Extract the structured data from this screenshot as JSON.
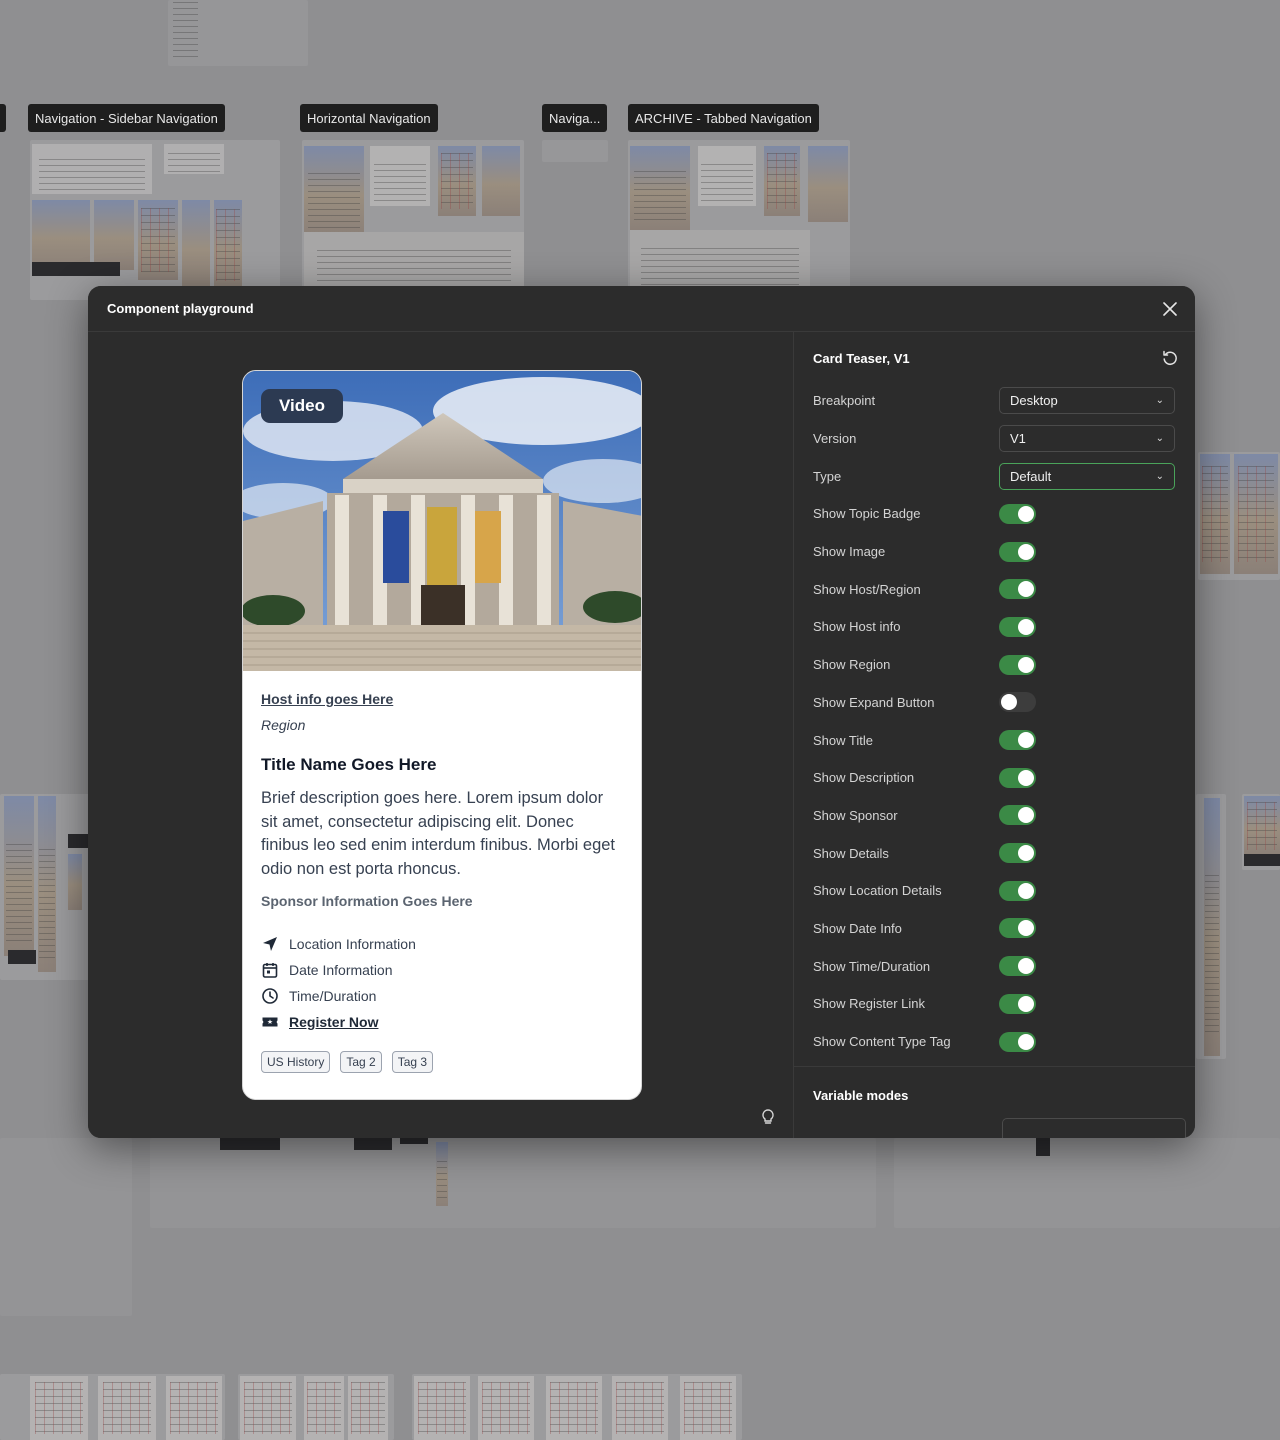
{
  "canvas": {
    "frame_labels": [
      {
        "id": "sidebar",
        "text": "Navigation - Sidebar Navigation"
      },
      {
        "id": "horizontal",
        "text": "Horizontal Navigation"
      },
      {
        "id": "naviga",
        "text": "Naviga..."
      },
      {
        "id": "archive",
        "text": "ARCHIVE - Tabbed Navigation"
      }
    ]
  },
  "modal": {
    "title": "Component playground",
    "close_icon": "close-icon"
  },
  "card": {
    "topic_badge": "Video",
    "image_alt": "museum-building-photo",
    "host_info": "Host info goes Here",
    "region": "Region",
    "title": "Title Name Goes Here",
    "description": "Brief description goes here. Lorem ipsum dolor sit amet, consectetur adipiscing elit. Donec finibus leo sed enim interdum finibus. Morbi eget odio non est porta rhoncus.",
    "sponsor": "Sponsor Information Goes Here",
    "details": {
      "location": "Location Information",
      "date": "Date Information",
      "time": "Time/Duration",
      "register": "Register Now"
    },
    "tags": [
      "US History",
      "Tag 2",
      "Tag 3"
    ]
  },
  "settings": {
    "title": "Card Teaser, V1",
    "selects": {
      "breakpoint": {
        "label": "Breakpoint",
        "value": "Desktop"
      },
      "version": {
        "label": "Version",
        "value": "V1"
      },
      "type": {
        "label": "Type",
        "value": "Default"
      }
    },
    "toggles": [
      {
        "label": "Show Topic Badge",
        "on": true
      },
      {
        "label": "Show Image",
        "on": true
      },
      {
        "label": "Show Host/Region",
        "on": true
      },
      {
        "label": "Show Host info",
        "on": true
      },
      {
        "label": "Show Region",
        "on": true
      },
      {
        "label": "Show Expand Button",
        "on": false
      },
      {
        "label": "Show Title",
        "on": true
      },
      {
        "label": "Show Description",
        "on": true
      },
      {
        "label": "Show Sponsor",
        "on": true
      },
      {
        "label": "Show Details",
        "on": true
      },
      {
        "label": "Show Location Details",
        "on": true
      },
      {
        "label": "Show Date Info",
        "on": true
      },
      {
        "label": "Show Time/Duration",
        "on": true
      },
      {
        "label": "Show Register Link",
        "on": true
      },
      {
        "label": "Show Content Type Tag",
        "on": true
      }
    ],
    "variable_modes_title": "Variable modes"
  },
  "colors": {
    "toggle_on": "#3b8a46",
    "toggle_off": "#3d3d3d",
    "modal_bg": "#2c2c2c",
    "badge_bg": "#2c3a52",
    "focus_border": "#4aa35a"
  }
}
